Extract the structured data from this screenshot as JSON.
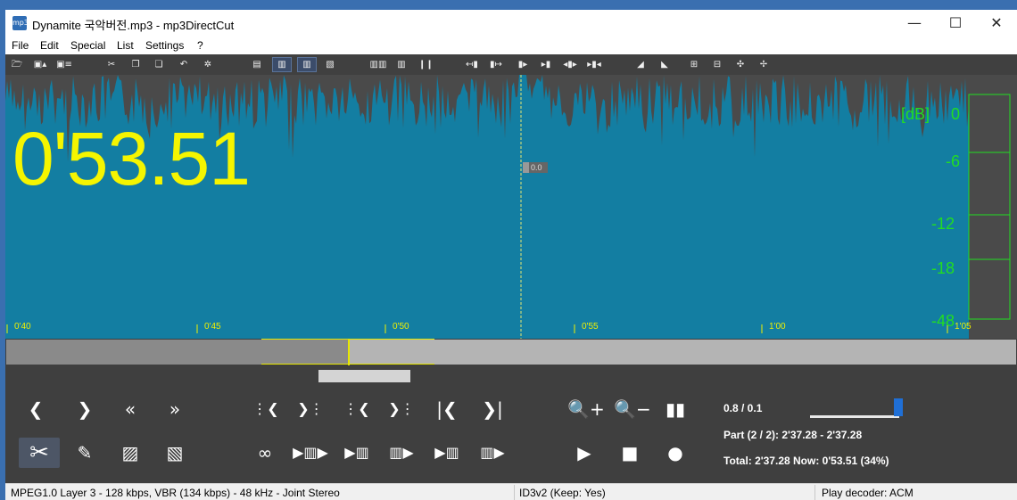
{
  "window": {
    "title": "Dynamite 국악버전.mp3 - mp3DirectCut",
    "icon_text": "mp3",
    "controls": {
      "minimize": "—",
      "maximize": "☐",
      "close": "✕"
    }
  },
  "menu": [
    "File",
    "Edit",
    "Special",
    "List",
    "Settings",
    "?"
  ],
  "display": {
    "time": "0'53.51",
    "cursor_value": "0.0",
    "ruler": [
      "0'40",
      "0'45",
      "0'50",
      "0'55",
      "1'00",
      "1'05"
    ],
    "db_unit": "[dB]",
    "db_levels": [
      "0",
      "-6",
      "-12",
      "-18",
      "-48"
    ]
  },
  "overview": {
    "played_fraction": 0.34
  },
  "controls": {
    "zoom_text": "0.8  /  0.1",
    "part_text": "Part (2 / 2): 2'37.28 - 2'37.28",
    "total_text": "Total: 2'37.28   Now: 0'53.51   (34%)",
    "volume_fraction": 0.98
  },
  "status": {
    "format": "MPEG1.0 Layer 3 - 128 kbps, VBR (134 kbps) - 48 kHz - Joint Stereo",
    "tag": "ID3v2 (Keep: Yes)",
    "decoder": "Play decoder: ACM"
  },
  "colors": {
    "timecode": "#f5f500",
    "waveform": "#137ea2",
    "meter": "#22dd22",
    "accent": "#1f6fd6"
  }
}
